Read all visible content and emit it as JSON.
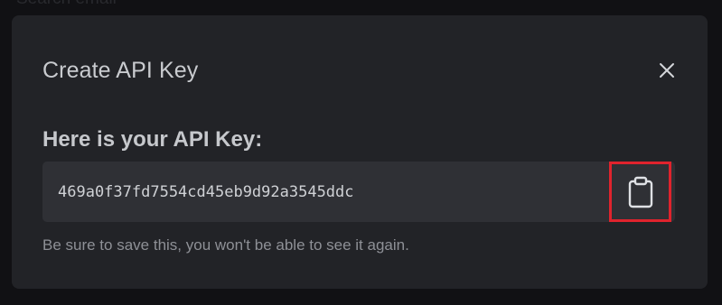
{
  "background": {
    "search_placeholder": "Search email"
  },
  "modal": {
    "title": "Create API Key",
    "close_icon": "close-icon",
    "heading": "Here is your API Key:",
    "api_key": "469a0f37fd7554cd45eb9d92a3545ddc",
    "copy_icon": "clipboard-icon",
    "helper_text": "Be sure to save this, you won't be able to see it again."
  },
  "colors": {
    "modal_bg": "#222327",
    "key_box_bg": "#2f3035",
    "highlight": "#e0232d",
    "text_primary": "#c9cbcf",
    "text_muted": "#8e9096"
  }
}
